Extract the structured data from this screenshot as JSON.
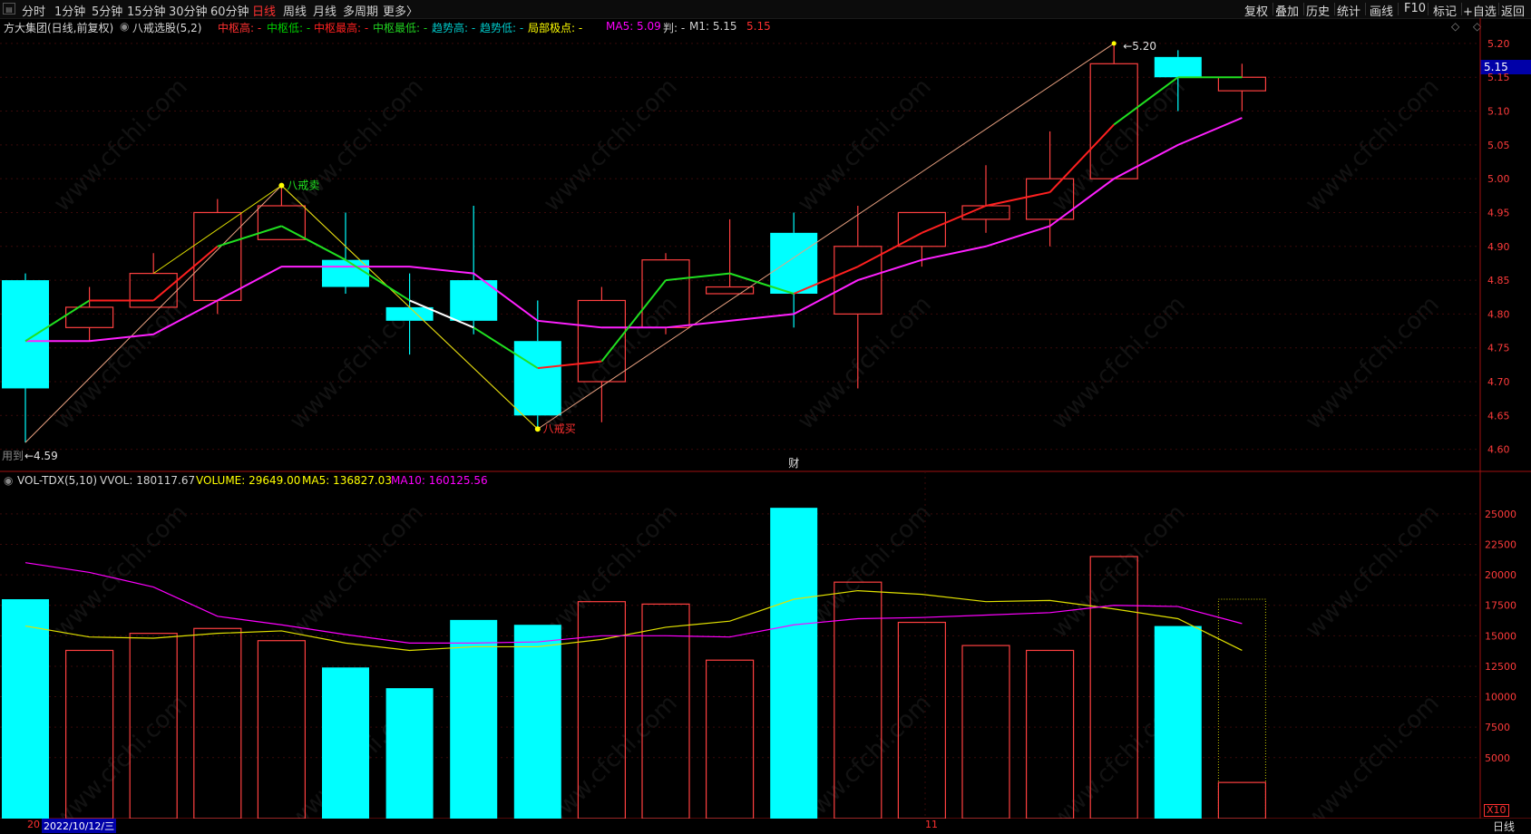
{
  "toolbar": {
    "left": [
      "分时",
      "1分钟",
      "5分钟",
      "15分钟",
      "30分钟",
      "60分钟",
      "日线",
      "周线",
      "月线",
      "多周期",
      "更多〉"
    ],
    "active": "日线",
    "right": [
      "复权",
      "叠加",
      "历史",
      "统计",
      "画线",
      "F10",
      "标记",
      "+自选",
      "返回"
    ]
  },
  "legend": {
    "title": "方大集团(日线,前复权)",
    "indicator": "八戒选股(5,2)",
    "items": [
      {
        "text": "中枢高: -",
        "color": "#ff3030"
      },
      {
        "text": "中枢低: -",
        "color": "#00d000"
      },
      {
        "text": "中枢最高: -",
        "color": "#ff2020"
      },
      {
        "text": "中枢最低: -",
        "color": "#20d020"
      },
      {
        "text": "趋势高: -",
        "color": "#00c8c8"
      },
      {
        "text": "趋势低: -",
        "color": "#00c8c8"
      },
      {
        "text": "局部极点: -",
        "color": "#ffff00"
      },
      {
        "text": "MA5: 5.09",
        "color": "#ff00ff"
      },
      {
        "text": "判: -",
        "color": "#d0d0d0"
      },
      {
        "text": "M1: 5.15",
        "color": "#d0d0d0"
      },
      {
        "text": "5.15",
        "color": "#ff3030"
      }
    ]
  },
  "volume_legend": {
    "title": "VOL-TDX(5,10)",
    "vvol": "VVOL: 180117.67",
    "volume": "VOLUME: 29649.00",
    "ma5": "MA5: 136827.03",
    "ma10": "MA10: 160125.56",
    "colors": {
      "vvol": "#d0d0d0",
      "volume": "#ffff00",
      "ma5": "#ffff00",
      "ma10": "#ff00ff"
    }
  },
  "price_box": "5.15",
  "annotations": {
    "sell": "八戒卖",
    "buy": "八戒买",
    "high": "5.20",
    "low": "4.59",
    "low_prefix": "用到",
    "finance_marker": "财"
  },
  "bottom": {
    "date": "2022/10/12/三",
    "prefix": "20",
    "month": "11",
    "period": "日线",
    "scale": "X10"
  },
  "watermark": "www.cfchi.com",
  "chart_data": [
    {
      "type": "candlestick",
      "title": "方大集团(日线,前复权)",
      "ylim": [
        4.57,
        5.22
      ],
      "y_ticks": [
        4.6,
        4.65,
        4.7,
        4.75,
        4.8,
        4.85,
        4.9,
        4.95,
        5.0,
        5.05,
        5.1,
        5.15,
        5.2
      ],
      "candles": [
        {
          "o": 4.85,
          "h": 4.86,
          "l": 4.61,
          "c": 4.69,
          "vol": 18000
        },
        {
          "o": 4.78,
          "h": 4.84,
          "l": 4.76,
          "c": 4.81,
          "vol": 13800
        },
        {
          "o": 4.81,
          "h": 4.89,
          "l": 4.81,
          "c": 4.86,
          "vol": 15200
        },
        {
          "o": 4.82,
          "h": 4.97,
          "l": 4.8,
          "c": 4.95,
          "vol": 15600
        },
        {
          "o": 4.91,
          "h": 4.99,
          "l": 4.91,
          "c": 4.96,
          "vol": 14600
        },
        {
          "o": 4.88,
          "h": 4.95,
          "l": 4.83,
          "c": 4.84,
          "vol": 12400
        },
        {
          "o": 4.81,
          "h": 4.86,
          "l": 4.74,
          "c": 4.79,
          "vol": 10700
        },
        {
          "o": 4.85,
          "h": 4.96,
          "l": 4.77,
          "c": 4.79,
          "vol": 16300
        },
        {
          "o": 4.76,
          "h": 4.82,
          "l": 4.63,
          "c": 4.65,
          "vol": 15900
        },
        {
          "o": 4.7,
          "h": 4.84,
          "l": 4.64,
          "c": 4.82,
          "vol": 17800
        },
        {
          "o": 4.78,
          "h": 4.89,
          "l": 4.77,
          "c": 4.88,
          "vol": 17600
        },
        {
          "o": 4.83,
          "h": 4.94,
          "l": 4.83,
          "c": 4.84,
          "vol": 13000
        },
        {
          "o": 4.92,
          "h": 4.95,
          "l": 4.78,
          "c": 4.83,
          "vol": 25500
        },
        {
          "o": 4.8,
          "h": 4.96,
          "l": 4.69,
          "c": 4.9,
          "vol": 19400
        },
        {
          "o": 4.9,
          "h": 4.95,
          "l": 4.87,
          "c": 4.95,
          "vol": 16100
        },
        {
          "o": 4.94,
          "h": 5.02,
          "l": 4.92,
          "c": 4.96,
          "vol": 14200
        },
        {
          "o": 4.94,
          "h": 5.07,
          "l": 4.9,
          "c": 5.0,
          "vol": 13800
        },
        {
          "o": 5.0,
          "h": 5.2,
          "l": 5.0,
          "c": 5.17,
          "vol": 21500
        },
        {
          "o": 5.18,
          "h": 5.19,
          "l": 5.1,
          "c": 5.15,
          "vol": 15800
        },
        {
          "o": 5.13,
          "h": 5.17,
          "l": 5.1,
          "c": 5.15,
          "vol": 2965
        }
      ],
      "ma5": [
        4.76,
        4.76,
        4.77,
        4.82,
        4.87,
        4.87,
        4.87,
        4.86,
        4.79,
        4.78,
        4.78,
        4.79,
        4.8,
        4.85,
        4.88,
        4.9,
        4.93,
        5.0,
        5.05,
        5.09
      ],
      "bajie_line": [
        4.76,
        4.82,
        4.82,
        4.9,
        4.93,
        4.88,
        4.82,
        4.78,
        4.72,
        4.73,
        4.85,
        4.86,
        4.83,
        4.87,
        4.92,
        4.96,
        4.98,
        5.08,
        5.15,
        5.15
      ],
      "bajie_line_colors": [
        "g",
        "g",
        "r",
        "r",
        "g",
        "g",
        "g",
        "w",
        "g",
        "r",
        "g",
        "g",
        "g",
        "r",
        "r",
        "r",
        "r",
        "r",
        "g",
        "g"
      ],
      "zigzag_yellow": [
        [
          4,
          4.99
        ],
        [
          8,
          4.63
        ]
      ],
      "zigzag_salmon": [
        [
          0,
          4.61
        ],
        [
          4,
          4.99
        ],
        [
          8,
          4.63
        ],
        [
          17,
          5.2
        ]
      ]
    },
    {
      "type": "bar",
      "title": "VOL-TDX(5,10)",
      "ylim": [
        0,
        27000
      ],
      "y_ticks": [
        5000,
        7500,
        10000,
        12500,
        15000,
        17500,
        20000,
        22500,
        25000
      ],
      "ma5": [
        15800,
        14900,
        14800,
        15200,
        15400,
        14400,
        13800,
        14100,
        14100,
        14700,
        15700,
        16200,
        18000,
        18700,
        18400,
        17800,
        17900,
        17200,
        16400,
        13800
      ],
      "ma10": [
        21000,
        20200,
        19000,
        16600,
        15900,
        15100,
        14400,
        14400,
        14500,
        15000,
        15000,
        14900,
        15900,
        16400,
        16500,
        16700,
        16900,
        17500,
        17400,
        16000
      ]
    }
  ]
}
